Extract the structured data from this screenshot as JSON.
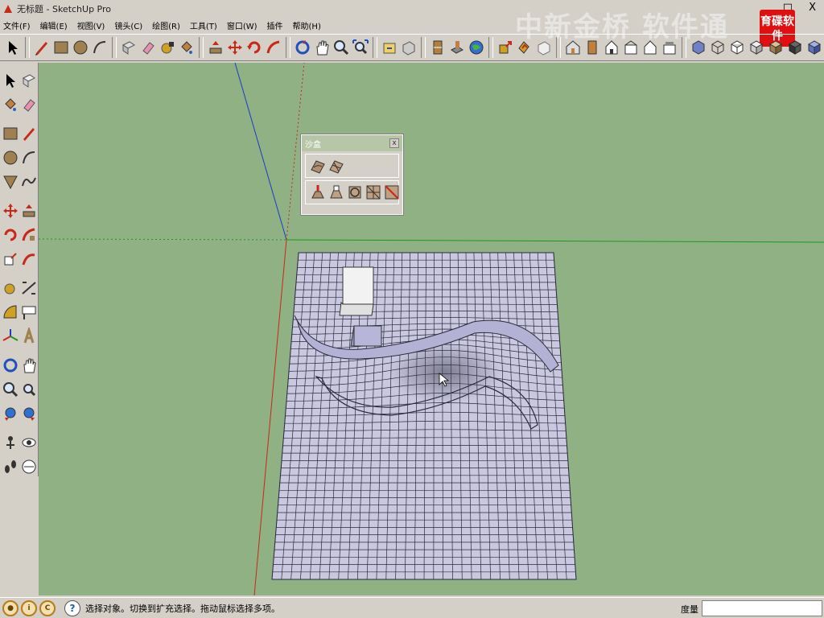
{
  "window": {
    "title": "无标题 - SketchUp Pro",
    "watermark": "中新金桥 软件通",
    "brand": "育碟软件",
    "controls": [
      "_",
      "□",
      "X"
    ]
  },
  "menu": [
    "文件(F)",
    "编辑(E)",
    "视图(V)",
    "镜头(C)",
    "绘图(R)",
    "工具(T)",
    "窗口(W)",
    "插件",
    "帮助(H)"
  ],
  "sandbox_panel": {
    "title": "沙盒",
    "close": "x",
    "row1_tools": [
      "from-contours-icon",
      "from-scratch-icon"
    ],
    "row2_tools": [
      "smoove-icon",
      "stamp-icon",
      "drape-icon",
      "add-detail-icon",
      "flip-edge-icon"
    ]
  },
  "status": {
    "hint": "选择对象。切换到扩充选择。拖动鼠标选择多项。",
    "measure_label": "度量",
    "measure_value": ""
  },
  "colors": {
    "viewport_bg": "#8fb184",
    "terrain_fill": "#c9c8e0",
    "terrain_grid": "#2a2a3a",
    "axis_blue": "#1a3cc8",
    "axis_green": "#1a9a1a",
    "axis_red": "#c8281a"
  }
}
